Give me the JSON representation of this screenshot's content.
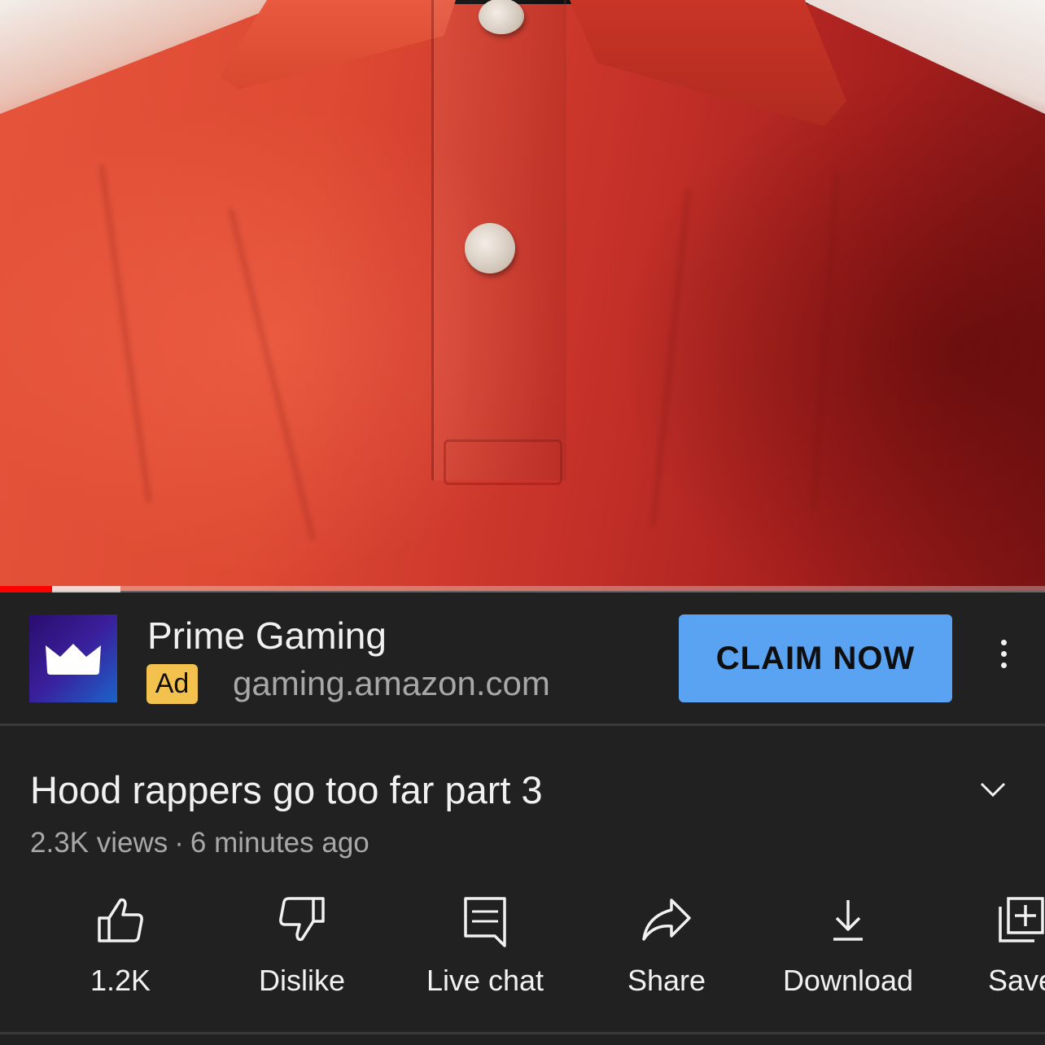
{
  "ad": {
    "advertiser": "Prime Gaming",
    "badge": "Ad",
    "url": "gaming.amazon.com",
    "cta_label": "CLAIM NOW",
    "logo_icon": "crown-icon",
    "cta_color": "#5aa2f2",
    "badge_color": "#f2c14e"
  },
  "player": {
    "progress_played_fraction": 0.05,
    "progress_buffered_fraction": 0.115,
    "progress_color": "#ff0000"
  },
  "video": {
    "title": "Hood rappers go too far part 3",
    "views": "2.3K views",
    "separator": "·",
    "age": "6 minutes ago"
  },
  "actions": [
    {
      "label": "1.2K",
      "icon": "thumbs-up-icon"
    },
    {
      "label": "Dislike",
      "icon": "thumbs-down-icon"
    },
    {
      "label": "Live chat",
      "icon": "chat-icon"
    },
    {
      "label": "Share",
      "icon": "share-icon"
    },
    {
      "label": "Download",
      "icon": "download-icon"
    },
    {
      "label": "Save",
      "icon": "save-playlist-icon"
    }
  ],
  "theme": {
    "background": "#212121",
    "text_primary": "#f1f1f1",
    "text_secondary": "#a8a8a8"
  }
}
